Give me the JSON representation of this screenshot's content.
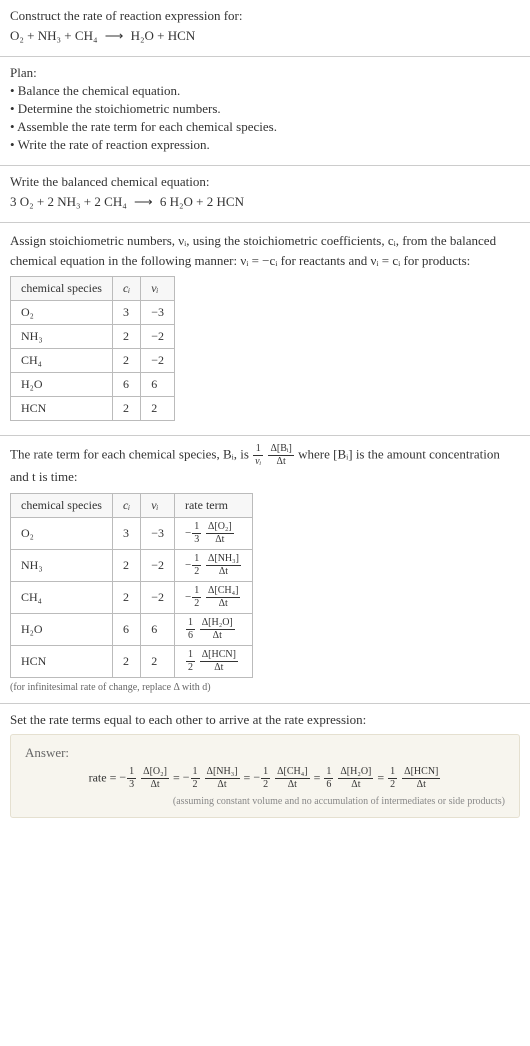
{
  "header": {
    "prompt": "Construct the rate of reaction expression for:",
    "equation_lhs": "O₂ + NH₃ + CH₄",
    "equation_arrow": "⟶",
    "equation_rhs": "H₂O + HCN"
  },
  "plan": {
    "title": "Plan:",
    "bullets": [
      "• Balance the chemical equation.",
      "• Determine the stoichiometric numbers.",
      "• Assemble the rate term for each chemical species.",
      "• Write the rate of reaction expression."
    ]
  },
  "balanced": {
    "title": "Write the balanced chemical equation:",
    "equation_lhs": "3 O₂ + 2 NH₃ + 2 CH₄",
    "equation_arrow": "⟶",
    "equation_rhs": "6 H₂O + 2 HCN"
  },
  "stoich": {
    "explain": "Assign stoichiometric numbers, νᵢ, using the stoichiometric coefficients, cᵢ, from the balanced chemical equation in the following manner: νᵢ = −cᵢ for reactants and νᵢ = cᵢ for products:",
    "headers": {
      "species": "chemical species",
      "ci": "cᵢ",
      "vi": "νᵢ"
    },
    "rows": [
      {
        "species": "O₂",
        "ci": "3",
        "vi": "−3"
      },
      {
        "species": "NH₃",
        "ci": "2",
        "vi": "−2"
      },
      {
        "species": "CH₄",
        "ci": "2",
        "vi": "−2"
      },
      {
        "species": "H₂O",
        "ci": "6",
        "vi": "6"
      },
      {
        "species": "HCN",
        "ci": "2",
        "vi": "2"
      }
    ]
  },
  "rateterm": {
    "explain_pre": "The rate term for each chemical species, Bᵢ, is ",
    "explain_frac_num": "1",
    "explain_frac_den": "νᵢ",
    "explain_frac2_num": "Δ[Bᵢ]",
    "explain_frac2_den": "Δt",
    "explain_post": " where [Bᵢ] is the amount concentration and t is time:",
    "headers": {
      "species": "chemical species",
      "ci": "cᵢ",
      "vi": "νᵢ",
      "rate": "rate term"
    },
    "rows": [
      {
        "species": "O₂",
        "ci": "3",
        "vi": "−3",
        "sign": "−",
        "coef_num": "1",
        "coef_den": "3",
        "d_num": "Δ[O₂]",
        "d_den": "Δt"
      },
      {
        "species": "NH₃",
        "ci": "2",
        "vi": "−2",
        "sign": "−",
        "coef_num": "1",
        "coef_den": "2",
        "d_num": "Δ[NH₃]",
        "d_den": "Δt"
      },
      {
        "species": "CH₄",
        "ci": "2",
        "vi": "−2",
        "sign": "−",
        "coef_num": "1",
        "coef_den": "2",
        "d_num": "Δ[CH₄]",
        "d_den": "Δt"
      },
      {
        "species": "H₂O",
        "ci": "6",
        "vi": "6",
        "sign": "",
        "coef_num": "1",
        "coef_den": "6",
        "d_num": "Δ[H₂O]",
        "d_den": "Δt"
      },
      {
        "species": "HCN",
        "ci": "2",
        "vi": "2",
        "sign": "",
        "coef_num": "1",
        "coef_den": "2",
        "d_num": "Δ[HCN]",
        "d_den": "Δt"
      }
    ],
    "note": "(for infinitesimal rate of change, replace Δ with d)"
  },
  "final": {
    "title": "Set the rate terms equal to each other to arrive at the rate expression:",
    "answer_label": "Answer:",
    "rate_label": "rate = ",
    "terms": [
      {
        "sign": "−",
        "coef_num": "1",
        "coef_den": "3",
        "d_num": "Δ[O₂]",
        "d_den": "Δt"
      },
      {
        "sign": "−",
        "coef_num": "1",
        "coef_den": "2",
        "d_num": "Δ[NH₃]",
        "d_den": "Δt"
      },
      {
        "sign": "−",
        "coef_num": "1",
        "coef_den": "2",
        "d_num": "Δ[CH₄]",
        "d_den": "Δt"
      },
      {
        "sign": "",
        "coef_num": "1",
        "coef_den": "6",
        "d_num": "Δ[H₂O]",
        "d_den": "Δt"
      },
      {
        "sign": "",
        "coef_num": "1",
        "coef_den": "2",
        "d_num": "Δ[HCN]",
        "d_den": "Δt"
      }
    ],
    "eq_sep": " = ",
    "note": "(assuming constant volume and no accumulation of intermediates or side products)"
  }
}
